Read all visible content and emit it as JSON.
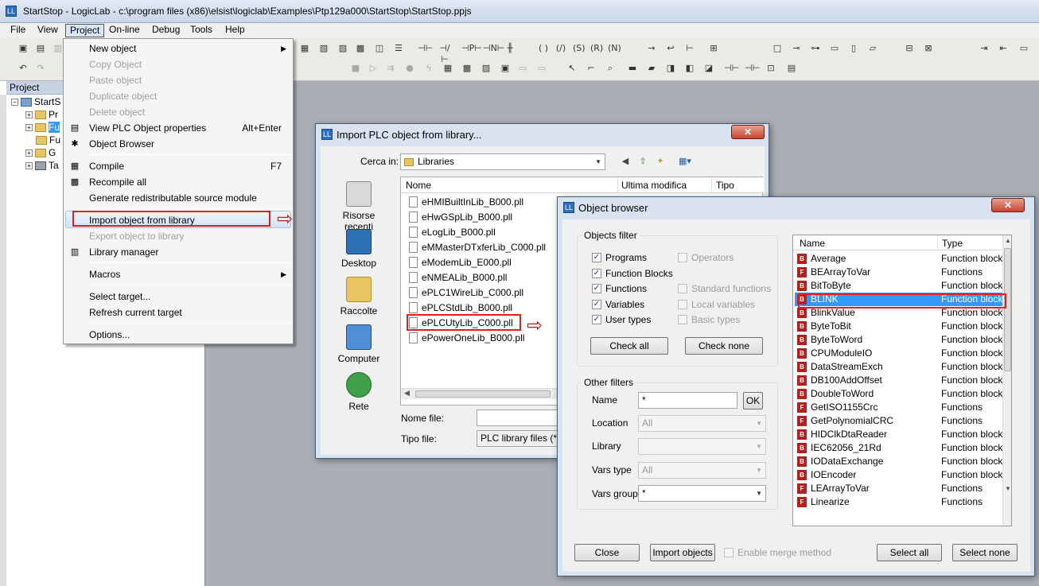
{
  "window": {
    "title": "StartStop - LogicLab - c:\\program files (x86)\\elsist\\logiclab\\Examples\\Ptp129a000\\StartStop\\StartStop.ppjs"
  },
  "menubar": [
    "File",
    "View",
    "Project",
    "On-line",
    "Debug",
    "Tools",
    "Help"
  ],
  "project_panel": {
    "title": "Project",
    "tree": [
      "StartS",
      "Pr",
      "Fu",
      "Fu",
      "G",
      "Ta"
    ]
  },
  "project_menu": {
    "items": [
      {
        "label": "New object",
        "enabled": true,
        "submenu": true
      },
      {
        "label": "Copy Object",
        "enabled": false
      },
      {
        "label": "Paste object",
        "enabled": false
      },
      {
        "label": "Duplicate object",
        "enabled": false
      },
      {
        "label": "Delete object",
        "enabled": false
      },
      {
        "label": "View PLC Object properties",
        "enabled": true,
        "shortcut": "Alt+Enter"
      },
      {
        "label": "Object Browser",
        "enabled": true
      },
      {
        "label": "Compile",
        "enabled": true,
        "shortcut": "F7"
      },
      {
        "label": "Recompile all",
        "enabled": true
      },
      {
        "label": "Generate redistributable source module",
        "enabled": true
      },
      {
        "label": "Import object from library",
        "enabled": true,
        "highlighted": true
      },
      {
        "label": "Export object to library",
        "enabled": false
      },
      {
        "label": "Library manager",
        "enabled": true
      },
      {
        "label": "Macros",
        "enabled": true,
        "submenu": true
      },
      {
        "label": "Select target...",
        "enabled": true
      },
      {
        "label": "Refresh current target",
        "enabled": true
      },
      {
        "label": "Options...",
        "enabled": true
      }
    ]
  },
  "import_dialog": {
    "title": "Import PLC object from library...",
    "look_in_label": "Cerca in:",
    "look_in_value": "Libraries",
    "places": [
      "Risorse recenti",
      "Desktop",
      "Raccolte",
      "Computer",
      "Rete"
    ],
    "columns": [
      "Nome",
      "Ultima modifica",
      "Tipo"
    ],
    "files": [
      "eHMIBuiltInLib_B000.pll",
      "eHwGSpLib_B000.pll",
      "eLogLib_B000.pll",
      "eMMasterDTxferLib_C000.pll",
      "eModemLib_E000.pll",
      "eNMEALib_B000.pll",
      "ePLC1WireLib_C000.pll",
      "ePLCStdLib_B000.pll",
      "ePLCUtyLib_C000.pll",
      "ePowerOneLib_B000.pll"
    ],
    "filename_label": "Nome file:",
    "filename_value": "",
    "filetype_label": "Tipo file:",
    "filetype_value": "PLC library files (*.pll)"
  },
  "object_browser": {
    "title": "Object browser",
    "objects_filter": {
      "title": "Objects filter",
      "left": [
        {
          "label": "Programs",
          "checked": true
        },
        {
          "label": "Function Blocks",
          "checked": true
        },
        {
          "label": "Functions",
          "checked": true
        },
        {
          "label": "Variables",
          "checked": true
        },
        {
          "label": "User types",
          "checked": true
        }
      ],
      "right": [
        {
          "label": "Operators",
          "checked": false
        },
        {
          "label": "Standard functions",
          "checked": false
        },
        {
          "label": "Local variables",
          "checked": false
        },
        {
          "label": "Basic types",
          "checked": false
        }
      ],
      "check_all": "Check all",
      "check_none": "Check none"
    },
    "other_filters": {
      "title": "Other filters",
      "name_label": "Name",
      "name_value": "*",
      "ok": "OK",
      "location_label": "Location",
      "location_value": "All",
      "library_label": "Library",
      "library_value": "",
      "vars_type_label": "Vars type",
      "vars_type_value": "All",
      "vars_group_label": "Vars group",
      "vars_group_value": "*"
    },
    "columns": [
      "Name",
      "Type"
    ],
    "rows": [
      {
        "name": "Average",
        "type": "Function blocks",
        "icon": "FB"
      },
      {
        "name": "BEArrayToVar",
        "type": "Functions",
        "icon": "F"
      },
      {
        "name": "BitToByte",
        "type": "Function blocks",
        "icon": "FB"
      },
      {
        "name": "BLINK",
        "type": "Function blocks",
        "icon": "FB",
        "selected": true
      },
      {
        "name": "BlinkValue",
        "type": "Function blocks",
        "icon": "FB"
      },
      {
        "name": "ByteToBit",
        "type": "Function blocks",
        "icon": "FB"
      },
      {
        "name": "ByteToWord",
        "type": "Function blocks",
        "icon": "FB"
      },
      {
        "name": "CPUModuleIO",
        "type": "Function blocks",
        "icon": "FB"
      },
      {
        "name": "DataStreamExch",
        "type": "Function blocks",
        "icon": "FB"
      },
      {
        "name": "DB100AddOffset",
        "type": "Function blocks",
        "icon": "FB"
      },
      {
        "name": "DoubleToWord",
        "type": "Function blocks",
        "icon": "FB"
      },
      {
        "name": "GetISO1155Crc",
        "type": "Functions",
        "icon": "F"
      },
      {
        "name": "GetPolynomialCRC",
        "type": "Functions",
        "icon": "F"
      },
      {
        "name": "HIDClkDtaReader",
        "type": "Function blocks",
        "icon": "FB"
      },
      {
        "name": "IEC62056_21Rd",
        "type": "Function blocks",
        "icon": "FB"
      },
      {
        "name": "IODataExchange",
        "type": "Function blocks",
        "icon": "FB"
      },
      {
        "name": "IOEncoder",
        "type": "Function blocks",
        "icon": "FB"
      },
      {
        "name": "LEArrayToVar",
        "type": "Functions",
        "icon": "F"
      },
      {
        "name": "Linearize",
        "type": "Functions",
        "icon": "F"
      }
    ],
    "buttons": {
      "close": "Close",
      "import": "Import objects",
      "merge": "Enable merge method",
      "select_all": "Select all",
      "select_none": "Select none"
    }
  },
  "colors": {
    "highlight_red": "#e02020",
    "selection_blue": "#3399ff"
  }
}
